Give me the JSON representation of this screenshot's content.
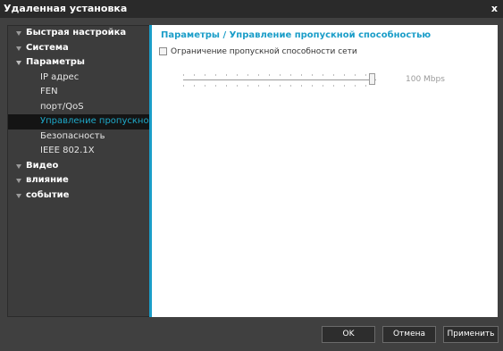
{
  "window": {
    "title": "Удаленная установка",
    "close_label": "x"
  },
  "sidebar": {
    "items": [
      {
        "label": "Быстрая настройка",
        "type": "category",
        "expanded": false
      },
      {
        "label": "Система",
        "type": "category",
        "expanded": false
      },
      {
        "label": "Параметры",
        "type": "category",
        "expanded": true
      },
      {
        "label": "IP адрес",
        "type": "child"
      },
      {
        "label": "FEN",
        "type": "child"
      },
      {
        "label": "порт/QoS",
        "type": "child"
      },
      {
        "label": "Управление пропускной спос",
        "type": "child",
        "selected": true
      },
      {
        "label": "Безопасность",
        "type": "child"
      },
      {
        "label": "IEEE 802.1X",
        "type": "child"
      },
      {
        "label": "Видео",
        "type": "category",
        "expanded": false
      },
      {
        "label": "влияние",
        "type": "category",
        "expanded": false
      },
      {
        "label": "событие",
        "type": "category",
        "expanded": false
      }
    ]
  },
  "main": {
    "heading": "Параметры / Управление пропускной способностью",
    "limit_checkbox": {
      "label": "Ограничение пропускной способности сети",
      "checked": false
    },
    "slider": {
      "value_text": "100 Mbps",
      "level": 1.0
    }
  },
  "buttons": {
    "ok": "OK",
    "cancel": "Отмена",
    "apply": "Применить"
  },
  "colors": {
    "accent": "#1a9dc8",
    "selected_text": "#1ea9c9"
  }
}
